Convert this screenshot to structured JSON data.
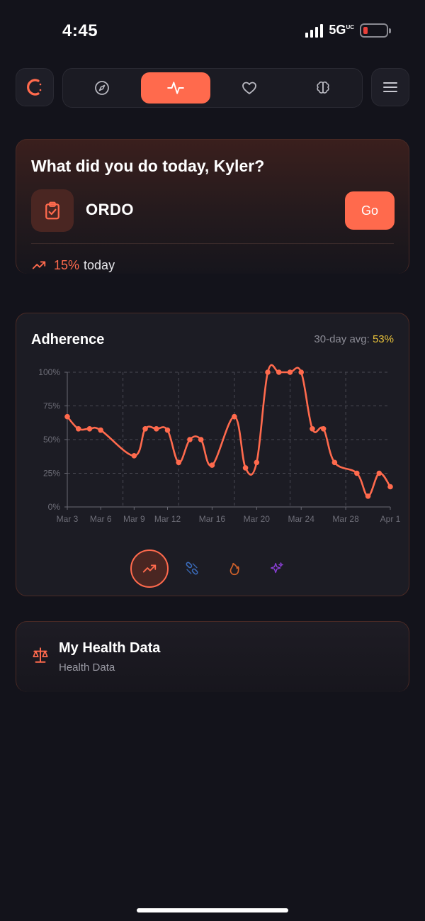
{
  "status_bar": {
    "time": "4:45",
    "network": "5G",
    "network_sup": "UC"
  },
  "nav": {
    "tabs": [
      {
        "icon": "compass-icon",
        "active": false
      },
      {
        "icon": "activity-icon",
        "active": true
      },
      {
        "icon": "heart-icon",
        "active": false
      },
      {
        "icon": "brain-icon",
        "active": false
      }
    ]
  },
  "today": {
    "title": "What did you do today, Kyler?",
    "item_name": "ORDO",
    "go_label": "Go",
    "trend_pct": "15%",
    "trend_word": "today"
  },
  "adherence": {
    "title": "Adherence",
    "avg_label": "30-day avg: ",
    "avg_value": "53%"
  },
  "chart_data": {
    "type": "line",
    "title": "Adherence",
    "x": [
      "Mar 3",
      "Mar 4",
      "Mar 5",
      "Mar 6",
      "Mar 7",
      "Mar 8",
      "Mar 9",
      "Mar 10",
      "Mar 11",
      "Mar 12",
      "Mar 13",
      "Mar 14",
      "Mar 15",
      "Mar 16",
      "Mar 17",
      "Mar 18",
      "Mar 19",
      "Mar 20",
      "Mar 21",
      "Mar 22",
      "Mar 23",
      "Mar 24",
      "Mar 25",
      "Mar 26",
      "Mar 27",
      "Mar 28",
      "Mar 29",
      "Mar 30",
      "Mar 31",
      "Apr 1"
    ],
    "x_ticks": [
      "Mar 3",
      "Mar 6",
      "Mar 9",
      "Mar 12",
      "Mar 16",
      "Mar 20",
      "Mar 24",
      "Mar 28",
      "Apr 1"
    ],
    "series": [
      {
        "values": [
          67,
          58,
          58,
          57,
          null,
          null,
          38,
          58,
          58,
          57,
          33,
          50,
          50,
          31,
          null,
          67,
          29,
          33,
          100,
          100,
          100,
          100,
          58,
          58,
          33,
          null,
          25,
          8,
          25,
          15
        ]
      }
    ],
    "y_ticks": [
      "0%",
      "25%",
      "50%",
      "75%",
      "100%"
    ],
    "ylim": [
      0,
      100
    ],
    "grid": true,
    "line_color": "#ff6a4d"
  },
  "chart_modes": [
    {
      "icon": "trend-up-icon",
      "active": true,
      "color": "#ff6a4d"
    },
    {
      "icon": "pills-icon",
      "active": false,
      "color": "#3a6ab8"
    },
    {
      "icon": "flame-icon",
      "active": false,
      "color": "#d2622a"
    },
    {
      "icon": "sparkles-icon",
      "active": false,
      "color": "#8a3fd6"
    }
  ],
  "health": {
    "title": "My Health Data",
    "subtitle": "Health Data"
  }
}
